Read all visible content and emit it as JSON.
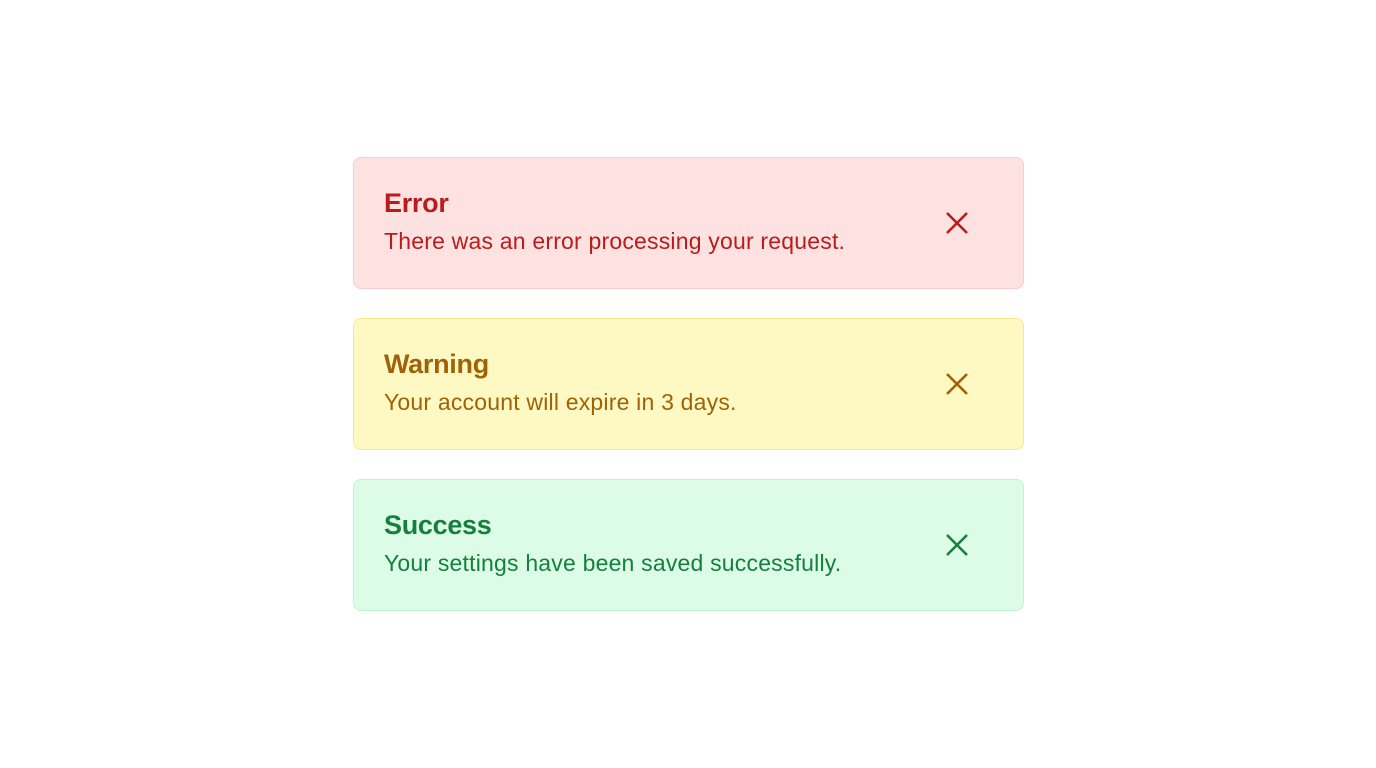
{
  "alerts": [
    {
      "kind": "error",
      "title": "Error",
      "message": "There was an error processing your request.",
      "close_icon": "close-icon",
      "colors": {
        "background": "#fee2e2",
        "border": "#fecaca",
        "text": "#b91c1c"
      }
    },
    {
      "kind": "warning",
      "title": "Warning",
      "message": "Your account will expire in 3 days.",
      "close_icon": "close-icon",
      "colors": {
        "background": "#fef9c3",
        "border": "#fde68a",
        "text": "#a16207"
      }
    },
    {
      "kind": "success",
      "title": "Success",
      "message": "Your settings have been saved successfully.",
      "close_icon": "close-icon",
      "colors": {
        "background": "#dcfce7",
        "border": "#bbf7d0",
        "text": "#15803d"
      }
    }
  ]
}
